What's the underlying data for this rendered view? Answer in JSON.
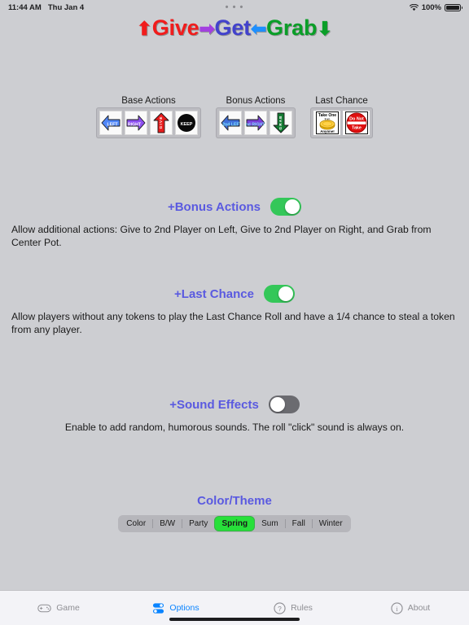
{
  "status_bar": {
    "time": "11:44 AM",
    "date": "Thu Jan 4",
    "center_dots": "• • •",
    "wifi_icon": "wifi-icon",
    "battery_percent": "100%",
    "battery_icon": "battery-full-icon"
  },
  "title": {
    "parts": [
      {
        "text": "⬆",
        "color": "#f11c1c",
        "kind": "arrow",
        "name": "up-arrow-icon"
      },
      {
        "text": "Give",
        "color": "#f11c1c",
        "kind": "word",
        "name": "give-word"
      },
      {
        "text": "➡",
        "color": "#a33fe0",
        "kind": "arrow",
        "name": "right-arrow-icon"
      },
      {
        "text": "Get",
        "color": "#4242cc",
        "kind": "word",
        "name": "get-word"
      },
      {
        "text": "⬅",
        "color": "#1e8fff",
        "kind": "arrow",
        "name": "left-arrow-icon"
      },
      {
        "text": "Grab",
        "color": "#0a9e28",
        "kind": "word",
        "name": "grab-word"
      },
      {
        "text": "⬇",
        "color": "#0a9e28",
        "kind": "arrow",
        "name": "down-arrow-icon"
      }
    ]
  },
  "legend": {
    "groups": [
      {
        "title": "Base Actions",
        "name": "base-actions-group",
        "tiles": [
          {
            "name": "tile-left",
            "label": "LEFT",
            "shape": "arrow-left",
            "color": "#4f86f7",
            "text_color": "#ffffff"
          },
          {
            "name": "tile-right",
            "label": "RIGHT",
            "shape": "arrow-right",
            "color": "#8d4ff0",
            "text_color": "#ffffff"
          },
          {
            "name": "tile-give",
            "label": "GIVE",
            "shape": "arrow-up",
            "color": "#e81c1c",
            "text_color": "#ffffff"
          },
          {
            "name": "tile-keep",
            "label": "KEEP",
            "shape": "circle",
            "color": "#0a0a0a",
            "text_color": "#ffffff"
          }
        ]
      },
      {
        "title": "Bonus Actions",
        "name": "bonus-actions-group",
        "tiles": [
          {
            "name": "tile-2nd-left",
            "label": "2nd LEFT",
            "shape": "arrow-left",
            "color": "#3f6fd8",
            "text_color": "#7fe3ff"
          },
          {
            "name": "tile-2nd-right",
            "label": "2nd RIGHT",
            "shape": "arrow-right",
            "color": "#7a3fd8",
            "text_color": "#7fe3ff"
          },
          {
            "name": "tile-grab",
            "label": "GRAB",
            "shape": "arrow-down",
            "color": "#137a32",
            "text_color": "#ffffff"
          }
        ]
      },
      {
        "title": "Last Chance",
        "name": "last-chance-group",
        "tiles": [
          {
            "name": "tile-take-one",
            "label": "Take One from Anyone!",
            "line1": "Take One",
            "line2": "from",
            "line3": "Anyone!",
            "shape": "coin-card",
            "color": "#f5c518",
            "text_color": "#000000"
          },
          {
            "name": "tile-do-not-take",
            "label": "Do Not Take",
            "line1": "Do Not",
            "line2": "Take",
            "shape": "stop-sign",
            "color": "#e01010",
            "text_color": "#ffffff"
          }
        ]
      }
    ]
  },
  "options": [
    {
      "name": "bonus-actions",
      "label": "+Bonus Actions",
      "toggle_state": "on",
      "description": "Allow additional actions: Give to 2nd Player on Left, Give to 2nd Player on Right, and Grab from Center Pot."
    },
    {
      "name": "last-chance",
      "label": "+Last Chance",
      "toggle_state": "on",
      "description": "Allow players without any tokens to play the Last Chance Roll and have a 1/4 chance to steal a token from any player."
    },
    {
      "name": "sound-effects",
      "label": "+Sound Effects",
      "toggle_state": "off",
      "description": "Enable to add random, humorous sounds. The roll \"click\" sound is always on."
    }
  ],
  "theme": {
    "title": "Color/Theme",
    "options": [
      "Color",
      "B/W",
      "Party",
      "Spring",
      "Sum",
      "Fall",
      "Winter"
    ],
    "selected": "Spring",
    "selected_color": "#27e03a"
  },
  "tabbar": {
    "tabs": [
      {
        "label": "Game",
        "icon": "gamepad-icon",
        "active": false
      },
      {
        "label": "Options",
        "icon": "switches-icon",
        "active": true
      },
      {
        "label": "Rules",
        "icon": "question-circle-icon",
        "active": false
      },
      {
        "label": "About",
        "icon": "info-circle-icon",
        "active": false
      }
    ],
    "active_color": "#0a84ff",
    "inactive_color": "#8e8e93"
  }
}
